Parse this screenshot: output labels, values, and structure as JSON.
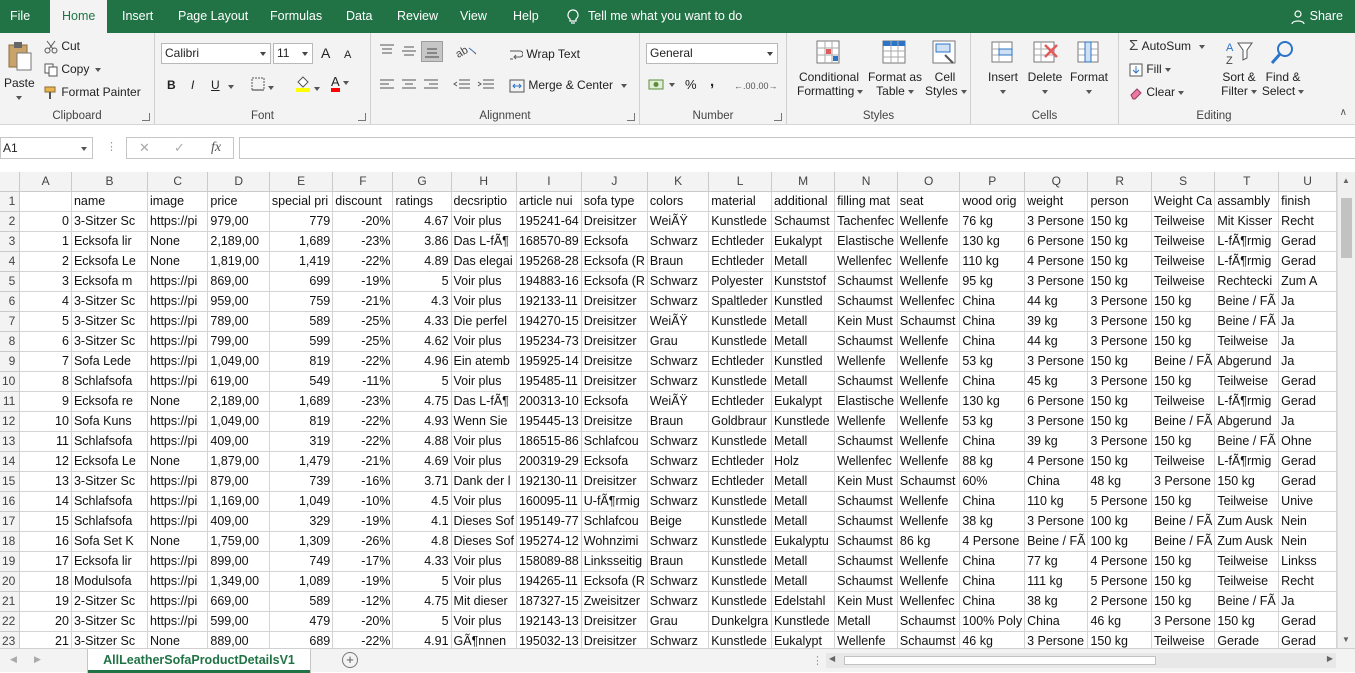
{
  "menu": {
    "file": "File",
    "home": "Home",
    "insert": "Insert",
    "page_layout": "Page Layout",
    "formulas": "Formulas",
    "data": "Data",
    "review": "Review",
    "view": "View",
    "help": "Help",
    "tell_me": "Tell me what you want to do",
    "share": "Share"
  },
  "ribbon": {
    "clipboard": {
      "paste": "Paste",
      "cut": "Cut",
      "copy": "Copy",
      "format_painter": "Format Painter",
      "label": "Clipboard"
    },
    "font": {
      "name": "Calibri",
      "size": "11",
      "bold": "B",
      "italic": "I",
      "underline": "U",
      "grow": "A",
      "shrink": "A",
      "font_color": "A",
      "label": "Font"
    },
    "alignment": {
      "wrap_text": "Wrap Text",
      "merge_center": "Merge & Center",
      "label": "Alignment"
    },
    "number": {
      "format": "General",
      "percent": "%",
      "comma": ",",
      "inc_decimal": ".00",
      "dec_decimal": ".00",
      "label": "Number"
    },
    "styles": {
      "conditional_l1": "Conditional",
      "conditional_l2": "Formatting",
      "format_table_l1": "Format as",
      "format_table_l2": "Table",
      "cell_styles_l1": "Cell",
      "cell_styles_l2": "Styles",
      "label": "Styles"
    },
    "cells": {
      "insert": "Insert",
      "delete": "Delete",
      "format": "Format",
      "label": "Cells"
    },
    "editing": {
      "autosum": "AutoSum",
      "fill": "Fill",
      "clear": "Clear",
      "sort_l1": "Sort &",
      "sort_l2": "Filter",
      "find_l1": "Find &",
      "find_l2": "Select",
      "label": "Editing"
    },
    "colors": {
      "accent": "#217346",
      "highlight": "#ffff00",
      "font_red": "#ff0000",
      "sort_blue": "#2b74c7"
    }
  },
  "formula_bar": {
    "name_box": "A1",
    "cancel": "✕",
    "enter": "✓",
    "fx": "fx",
    "content": ""
  },
  "columns": [
    "A",
    "B",
    "C",
    "D",
    "E",
    "F",
    "G",
    "H",
    "I",
    "J",
    "K",
    "L",
    "M",
    "N",
    "O",
    "P",
    "Q",
    "R",
    "S",
    "T",
    "U"
  ],
  "rows": [
    {
      "n": "1",
      "cells": [
        "",
        "name",
        "image",
        "price",
        "special pri",
        "discount",
        "ratings",
        "decsriptio",
        "article nui",
        "sofa type",
        "colors",
        "material",
        "additional",
        "filling mat",
        "seat",
        "wood orig",
        "weight",
        "person",
        "Weight Ca",
        "assambly",
        "finish"
      ]
    },
    {
      "n": "2",
      "cells": [
        "0",
        "3-Sitzer Sc",
        "https://pi",
        "979,00",
        "779",
        "-20%",
        "4.67",
        "Voir plus",
        "195241-64",
        "Dreisitzer",
        "WeiÃŸ",
        "Kunstlede",
        "Schaumst",
        "Tachenfec",
        "Wellenfe",
        "76 kg",
        "3 Persone",
        "150 kg",
        "Teilweise",
        "Mit Kisser",
        "Recht"
      ]
    },
    {
      "n": "3",
      "cells": [
        "1",
        "Ecksofa lir",
        "None",
        "2,189,00",
        "1,689",
        "-23%",
        "3.86",
        "Das L-fÃ¶",
        "168570-89",
        "Ecksofa",
        "Schwarz",
        "Echtleder",
        "Eukalypt",
        "Elastische",
        "Wellenfe",
        "130 kg",
        "6 Persone",
        "150 kg",
        "Teilweise",
        "L-fÃ¶rmig",
        "Gerad"
      ]
    },
    {
      "n": "4",
      "cells": [
        "2",
        "Ecksofa Le",
        "None",
        "1,819,00",
        "1,419",
        "-22%",
        "4.89",
        "Das elegai",
        "195268-28",
        "Ecksofa (R",
        "Braun",
        "Echtleder",
        "Metall",
        "Wellenfec",
        "Wellenfe",
        "110 kg",
        "4 Persone",
        "150 kg",
        "Teilweise",
        "L-fÃ¶rmig",
        "Gerad"
      ]
    },
    {
      "n": "5",
      "cells": [
        "3",
        "Ecksofa m",
        "https://pi",
        "869,00",
        "699",
        "-19%",
        "5",
        "Voir plus",
        "194883-16",
        "Ecksofa (R",
        "Schwarz",
        "Polyester",
        "Kunststof",
        "Schaumst",
        "Wellenfe",
        "95 kg",
        "3 Persone",
        "150 kg",
        "Teilweise",
        "Rechtecki",
        "Zum A"
      ]
    },
    {
      "n": "6",
      "cells": [
        "4",
        "3-Sitzer Sc",
        "https://pi",
        "959,00",
        "759",
        "-21%",
        "4.3",
        "Voir plus",
        "192133-11",
        "Dreisitzer",
        "Schwarz",
        "Spaltleder",
        "Kunstled",
        "Schaumst",
        "Wellenfec",
        "China",
        "44 kg",
        "3 Persone",
        "150 kg",
        "Beine / FÃ",
        "Ja"
      ]
    },
    {
      "n": "7",
      "cells": [
        "5",
        "3-Sitzer Sc",
        "https://pi",
        "789,00",
        "589",
        "-25%",
        "4.33",
        "Die perfel",
        "194270-15",
        "Dreisitzer",
        "WeiÃŸ",
        "Kunstlede",
        "Metall",
        "Kein Must",
        "Schaumst",
        "China",
        "39 kg",
        "3 Persone",
        "150 kg",
        "Beine / FÃ",
        "Ja"
      ]
    },
    {
      "n": "8",
      "cells": [
        "6",
        "3-Sitzer Sc",
        "https://pi",
        "799,00",
        "599",
        "-25%",
        "4.62",
        "Voir plus",
        "195234-73",
        "Dreisitzer",
        "Grau",
        "Kunstlede",
        "Metall",
        "Schaumst",
        "Wellenfe",
        "China",
        "44 kg",
        "3 Persone",
        "150 kg",
        "Teilweise",
        "Ja"
      ]
    },
    {
      "n": "9",
      "cells": [
        "7",
        "Sofa Lede",
        "https://pi",
        "1,049,00",
        "819",
        "-22%",
        "4.96",
        "Ein atemb",
        "195925-14",
        "Dreisitze",
        "Schwarz",
        "Echtleder",
        "Kunstled",
        "Wellenfe",
        "Wellenfe",
        "53 kg",
        "3 Persone",
        "150 kg",
        "Beine / FÃ",
        "Abgerund",
        "Ja"
      ]
    },
    {
      "n": "10",
      "cells": [
        "8",
        "Schlafsofa",
        "https://pi",
        "619,00",
        "549",
        "-11%",
        "5",
        "Voir plus",
        "195485-11",
        "Dreisitzer",
        "Schwarz",
        "Kunstlede",
        "Metall",
        "Schaumst",
        "Wellenfe",
        "China",
        "45 kg",
        "3 Persone",
        "150 kg",
        "Teilweise",
        "Gerad"
      ]
    },
    {
      "n": "11",
      "cells": [
        "9",
        "Ecksofa re",
        "None",
        "2,189,00",
        "1,689",
        "-23%",
        "4.75",
        "Das L-fÃ¶",
        "200313-10",
        "Ecksofa",
        "WeiÃŸ",
        "Echtleder",
        "Eukalypt",
        "Elastische",
        "Wellenfe",
        "130 kg",
        "6 Persone",
        "150 kg",
        "Teilweise",
        "L-fÃ¶rmig",
        "Gerad"
      ]
    },
    {
      "n": "12",
      "cells": [
        "10",
        "Sofa Kuns",
        "https://pi",
        "1,049,00",
        "819",
        "-22%",
        "4.93",
        "Wenn Sie",
        "195445-13",
        "Dreisitze",
        "Braun",
        "Goldbraur",
        "Kunstlede",
        "Wellenfe",
        "Wellenfe",
        "53 kg",
        "3 Persone",
        "150 kg",
        "Beine / FÃ",
        "Abgerund",
        "Ja"
      ]
    },
    {
      "n": "13",
      "cells": [
        "11",
        "Schlafsofa",
        "https://pi",
        "409,00",
        "319",
        "-22%",
        "4.88",
        "Voir plus",
        "186515-86",
        "Schlafcou",
        "Schwarz",
        "Kunstlede",
        "Metall",
        "Schaumst",
        "Wellenfe",
        "China",
        "39 kg",
        "3 Persone",
        "150 kg",
        "Beine / FÃ",
        "Ohne"
      ]
    },
    {
      "n": "14",
      "cells": [
        "12",
        "Ecksofa Le",
        "None",
        "1,879,00",
        "1,479",
        "-21%",
        "4.69",
        "Voir plus",
        "200319-29",
        "Ecksofa",
        "Schwarz",
        "Echtleder",
        "Holz",
        "Wellenfec",
        "Wellenfe",
        "88 kg",
        "4 Persone",
        "150 kg",
        "Teilweise",
        "L-fÃ¶rmig",
        "Gerad"
      ]
    },
    {
      "n": "15",
      "cells": [
        "13",
        "3-Sitzer Sc",
        "https://pi",
        "879,00",
        "739",
        "-16%",
        "3.71",
        "Dank der l",
        "192130-11",
        "Dreisitzer",
        "Schwarz",
        "Echtleder",
        "Metall",
        "Kein Must",
        "Schaumst",
        "60%",
        "China",
        "48 kg",
        "3 Persone",
        "150 kg",
        "Gerad"
      ]
    },
    {
      "n": "16",
      "cells": [
        "14",
        "Schlafsofa",
        "https://pi",
        "1,169,00",
        "1,049",
        "-10%",
        "4.5",
        "Voir plus",
        "160095-11",
        "U-fÃ¶rmig",
        "Schwarz",
        "Kunstlede",
        "Metall",
        "Schaumst",
        "Wellenfe",
        "China",
        "110 kg",
        "5 Persone",
        "150 kg",
        "Teilweise",
        "Unive"
      ]
    },
    {
      "n": "17",
      "cells": [
        "15",
        "Schlafsofa",
        "https://pi",
        "409,00",
        "329",
        "-19%",
        "4.1",
        "Dieses Sof",
        "195149-77",
        "Schlafcou",
        "Beige",
        "Kunstlede",
        "Metall",
        "Schaumst",
        "Wellenfe",
        "38 kg",
        "3 Persone",
        "100 kg",
        "Beine / FÃ",
        "Zum Ausk",
        "Nein"
      ]
    },
    {
      "n": "18",
      "cells": [
        "16",
        "Sofa Set K",
        "None",
        "1,759,00",
        "1,309",
        "-26%",
        "4.8",
        "Dieses Sof",
        "195274-12",
        "Wohnzimi",
        "Schwarz",
        "Kunstlede",
        "Eukalyptu",
        "Schaumst",
        "86 kg",
        "4 Persone",
        "Beine / FÃ",
        "100 kg",
        "Beine / FÃ",
        "Zum Ausk",
        "Nein"
      ]
    },
    {
      "n": "19",
      "cells": [
        "17",
        "Ecksofa lir",
        "https://pi",
        "899,00",
        "749",
        "-17%",
        "4.33",
        "Voir plus",
        "158089-88",
        "Linksseitig",
        "Braun",
        "Kunstlede",
        "Metall",
        "Schaumst",
        "Wellenfe",
        "China",
        "77 kg",
        "4 Persone",
        "150 kg",
        "Teilweise",
        "Linkss"
      ]
    },
    {
      "n": "20",
      "cells": [
        "18",
        "Modulsofa",
        "https://pi",
        "1,349,00",
        "1,089",
        "-19%",
        "5",
        "Voir plus",
        "194265-11",
        "Ecksofa (R",
        "Schwarz",
        "Kunstlede",
        "Metall",
        "Schaumst",
        "Wellenfe",
        "China",
        "111 kg",
        "5 Persone",
        "150 kg",
        "Teilweise",
        "Recht"
      ]
    },
    {
      "n": "21",
      "cells": [
        "19",
        "2-Sitzer Sc",
        "https://pi",
        "669,00",
        "589",
        "-12%",
        "4.75",
        "Mit dieser",
        "187327-15",
        "Zweisitzer",
        "Schwarz",
        "Kunstlede",
        "Edelstahl",
        "Kein Must",
        "Wellenfec",
        "China",
        "38 kg",
        "2 Persone",
        "150 kg",
        "Beine / FÃ",
        "Ja"
      ]
    },
    {
      "n": "22",
      "cells": [
        "20",
        "3-Sitzer Sc",
        "https://pi",
        "599,00",
        "479",
        "-20%",
        "5",
        "Voir plus",
        "192143-13",
        "Dreisitzer",
        "Grau",
        "Dunkelgra",
        "Kunstlede",
        "Metall",
        "Schaumst",
        "100% Poly",
        "China",
        "46 kg",
        "3 Persone",
        "150 kg",
        "Gerad"
      ]
    },
    {
      "n": "23",
      "cells": [
        "21",
        "3-Sitzer Sc",
        "None",
        "889,00",
        "689",
        "-22%",
        "4.91",
        "GÃ¶nnen",
        "195032-13",
        "Dreisitzer",
        "Schwarz",
        "Kunstlede",
        "Eukalypt",
        "Wellenfe",
        "Schaumst",
        "46 kg",
        "3 Persone",
        "150 kg",
        "Teilweise",
        "Gerade",
        "Gerad"
      ]
    }
  ],
  "sheet": {
    "tab_name": "AllLeatherSofaProductDetailsV1",
    "add_sheet": "+"
  }
}
